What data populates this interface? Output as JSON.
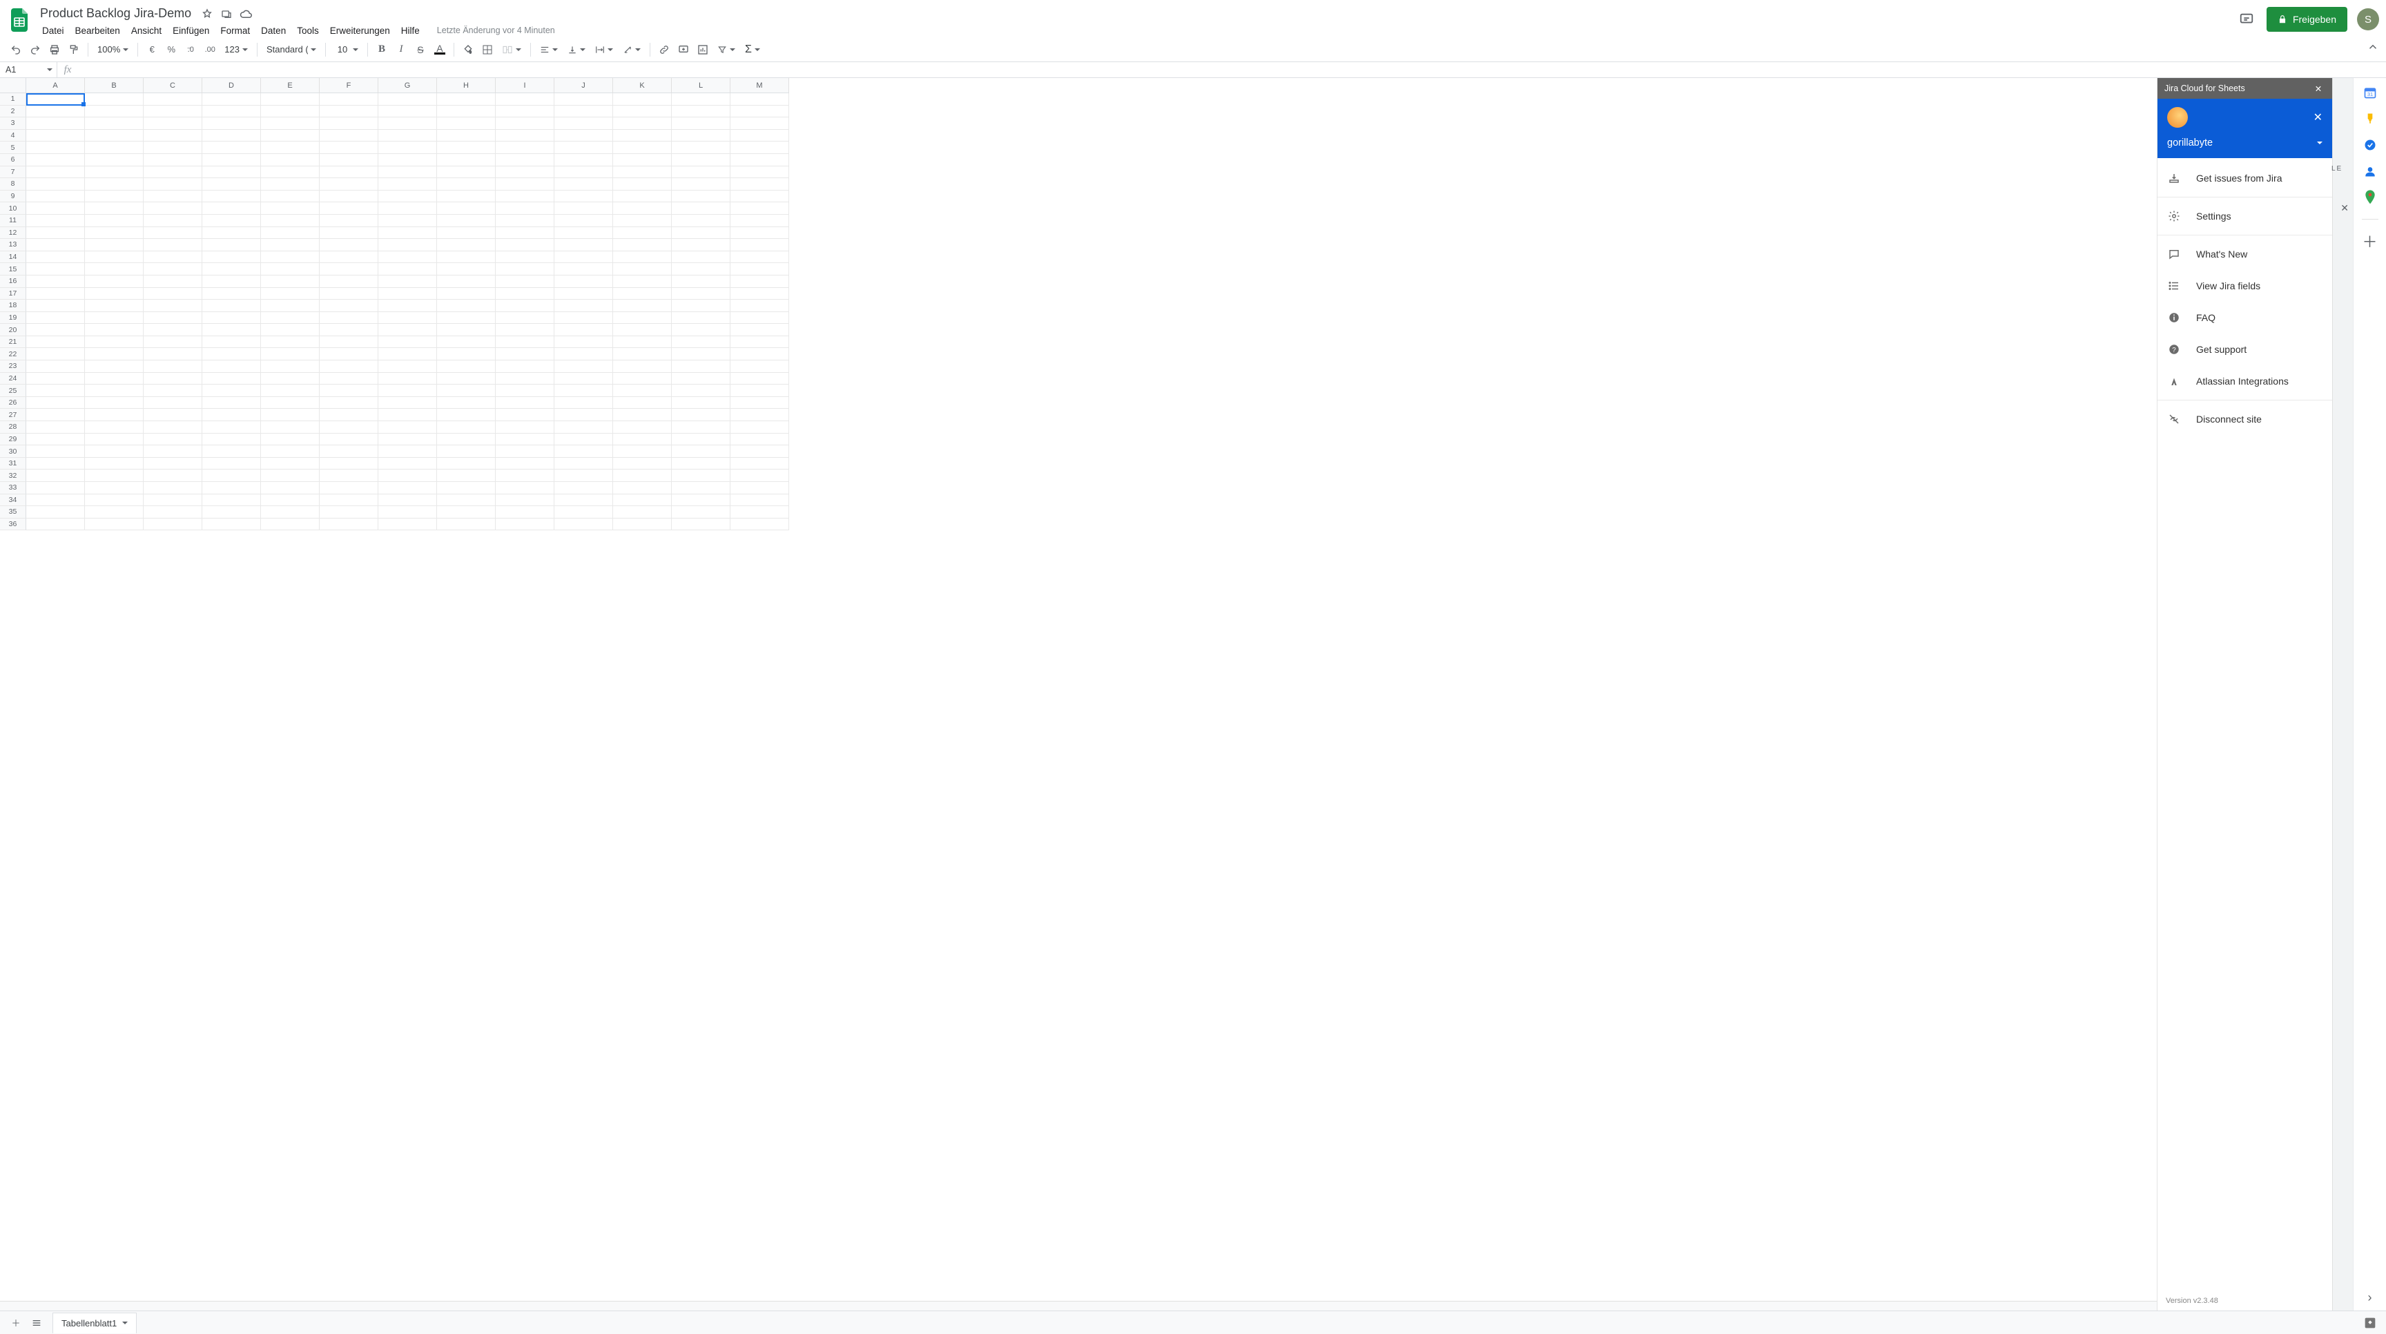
{
  "doc": {
    "title": "Product Backlog Jira-Demo",
    "last_edit": "Letzte Änderung vor 4 Minuten",
    "share_label": "Freigeben",
    "avatar_letter": "S"
  },
  "menus": [
    "Datei",
    "Bearbeiten",
    "Ansicht",
    "Einfügen",
    "Format",
    "Daten",
    "Tools",
    "Erweiterungen",
    "Hilfe"
  ],
  "toolbar": {
    "zoom": "100%",
    "currency": "€",
    "percent": "%",
    "dec_less": ".0",
    "dec_more": ".00",
    "numfmt": "123",
    "font": "Standard (...",
    "font_size": "10"
  },
  "cellref": "A1",
  "columns": [
    "A",
    "B",
    "C",
    "D",
    "E",
    "F",
    "G",
    "H",
    "I",
    "J",
    "K",
    "L",
    "M"
  ],
  "rows": 36,
  "sheet_tab": "Tabellenblatt1",
  "jira": {
    "panel_title": "Jira Cloud for Sheets",
    "site": "gorillabyte",
    "items_top": [
      {
        "icon": "get",
        "label": "Get issues from Jira"
      },
      {
        "icon": "gear",
        "label": "Settings"
      }
    ],
    "items_mid": [
      {
        "icon": "chat",
        "label": "What's New"
      },
      {
        "icon": "list",
        "label": "View Jira fields"
      },
      {
        "icon": "info",
        "label": "FAQ"
      },
      {
        "icon": "help",
        "label": "Get support"
      },
      {
        "icon": "atl",
        "label": "Atlassian Integrations"
      }
    ],
    "items_bot": [
      {
        "icon": "unlink",
        "label": "Disconnect site"
      }
    ],
    "version": "Version v2.3.48"
  },
  "behind_label": "LE",
  "rail_colors": {
    "cal": "#4285f4",
    "keep": "#fbbc04",
    "tasks": "#4285f4",
    "contacts": "#1a73e8",
    "maps": "#34a853"
  }
}
